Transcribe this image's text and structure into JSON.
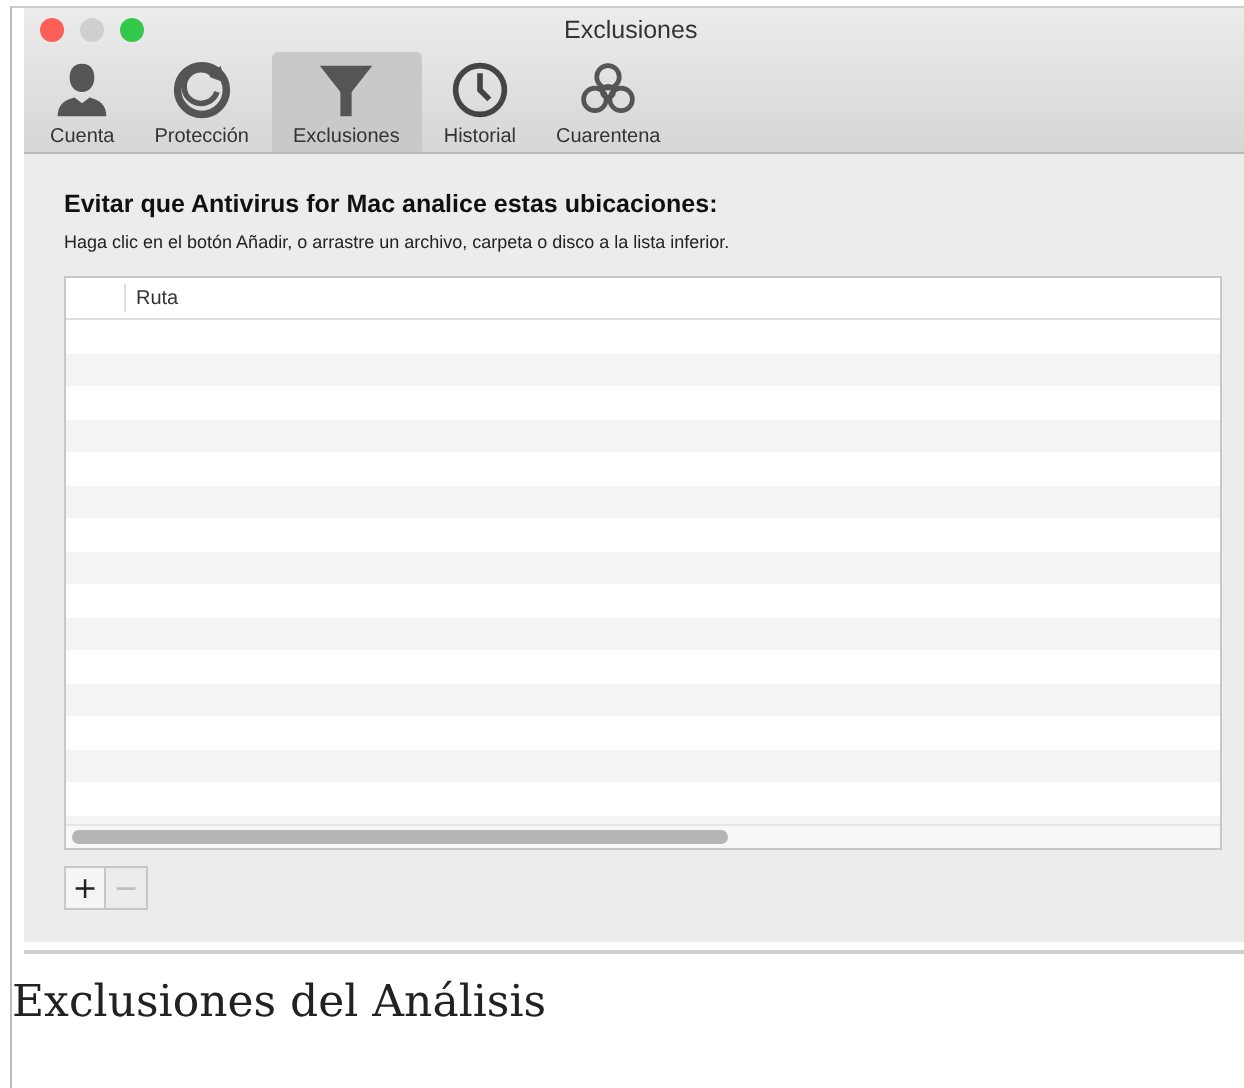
{
  "window": {
    "title": "Exclusiones"
  },
  "tabs": [
    {
      "label": "Cuenta",
      "selected": false
    },
    {
      "label": "Protección",
      "selected": false
    },
    {
      "label": "Exclusiones",
      "selected": true
    },
    {
      "label": "Historial",
      "selected": false
    },
    {
      "label": "Cuarentena",
      "selected": false
    }
  ],
  "heading": "Evitar que Antivirus for Mac analice estas ubicaciones:",
  "instructions": "Haga clic en el botón Añadir, o arrastre un archivo, carpeta o disco a la lista inferior.",
  "table": {
    "columns": [
      {
        "label": "Ruta"
      }
    ]
  },
  "buttons": [
    {
      "label": "+",
      "disabled": false
    },
    {
      "label": "−",
      "disabled": true
    }
  ],
  "caption": "Exclusiones del Análisis"
}
